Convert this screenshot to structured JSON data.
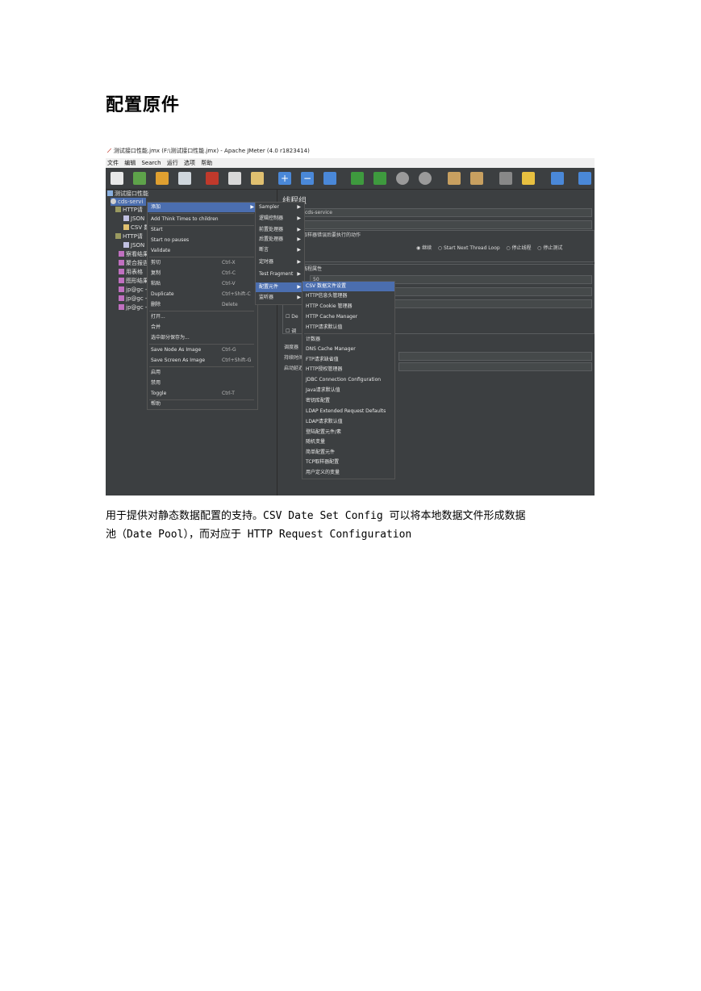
{
  "page_title": "配置原件",
  "window": {
    "title": "测试接口性能.jmx (F:\\测试接口性能.jmx) - Apache JMeter (4.0 r1823414)",
    "menus": [
      "文件",
      "编辑",
      "Search",
      "运行",
      "选项",
      "帮助"
    ]
  },
  "tree": {
    "items": [
      "测试接口性能",
      "cds-servi",
      "HTTP请",
      "JSON",
      "CSV 数",
      "HTTP请",
      "JSON",
      "察看结果",
      "聚合报告",
      "用表格",
      "图形结果",
      "jp@gc -",
      "jp@gc -",
      "jp@gc -"
    ]
  },
  "right_panel": {
    "heading": "线程组",
    "name_value": "cds-service",
    "action_label": "取样器错误后要执行的动作",
    "radios": [
      "继续",
      "Start Next Thread Loop",
      "停止线程",
      "停止测试"
    ],
    "props_label": "线程属性",
    "threads_value": "50",
    "chk1": "De",
    "chk2": "调",
    "label_duration": "持续时间",
    "label_delay": "启动延迟",
    "label_sched": "调度器"
  },
  "context_menu": {
    "items": [
      {
        "label": "添加",
        "shortcut": ""
      },
      {
        "label": "Add Think Times to children",
        "shortcut": ""
      },
      {
        "label": "Start",
        "shortcut": ""
      },
      {
        "label": "Start no pauses",
        "shortcut": ""
      },
      {
        "label": "Validate",
        "shortcut": ""
      },
      {
        "label": "剪切",
        "shortcut": "Ctrl-X"
      },
      {
        "label": "复制",
        "shortcut": "Ctrl-C"
      },
      {
        "label": "粘贴",
        "shortcut": "Ctrl-V"
      },
      {
        "label": "Duplicate",
        "shortcut": "Ctrl+Shift-C"
      },
      {
        "label": "删除",
        "shortcut": "Delete"
      },
      {
        "label": "打开...",
        "shortcut": ""
      },
      {
        "label": "合并",
        "shortcut": ""
      },
      {
        "label": "选中部分保存为...",
        "shortcut": ""
      },
      {
        "label": "Save Node As Image",
        "shortcut": "Ctrl-G"
      },
      {
        "label": "Save Screen As Image",
        "shortcut": "Ctrl+Shift-G"
      },
      {
        "label": "启用",
        "shortcut": ""
      },
      {
        "label": "禁用",
        "shortcut": ""
      },
      {
        "label": "Toggle",
        "shortcut": "Ctrl-T"
      },
      {
        "label": "帮助",
        "shortcut": ""
      }
    ]
  },
  "add_submenu": {
    "items": [
      "Sampler",
      "逻辑控制器",
      "前置处理器",
      "后置处理器",
      "断言",
      "定时器",
      "Test Fragment",
      "配置元件",
      "监听器"
    ]
  },
  "config_submenu": {
    "items": [
      "CSV 数据文件设置",
      "HTTP信息头管理器",
      "HTTP Cookie 管理器",
      "HTTP Cache Manager",
      "HTTP请求默认值",
      "计数器",
      "DNS Cache Manager",
      "FTP请求缺省值",
      "HTTP授权管理器",
      "JDBC Connection Configuration",
      "Java请求默认值",
      "密钥库配置",
      "LDAP Extended Request Defaults",
      "LDAP请求默认值",
      "登陆配置元件/素",
      "随机变量",
      "简单配置元件",
      "TCP取样器配置",
      "用户定义的变量"
    ]
  },
  "caption": {
    "line1": "用于提供对静态数据配置的支持。CSV Date Set Config 可以将本地数据文件形成数据",
    "line2": "池（Date Pool），而对应于 HTTP Request Configuration"
  },
  "colors": {
    "background": "#3c3f41",
    "selection": "#4b6eaf"
  }
}
